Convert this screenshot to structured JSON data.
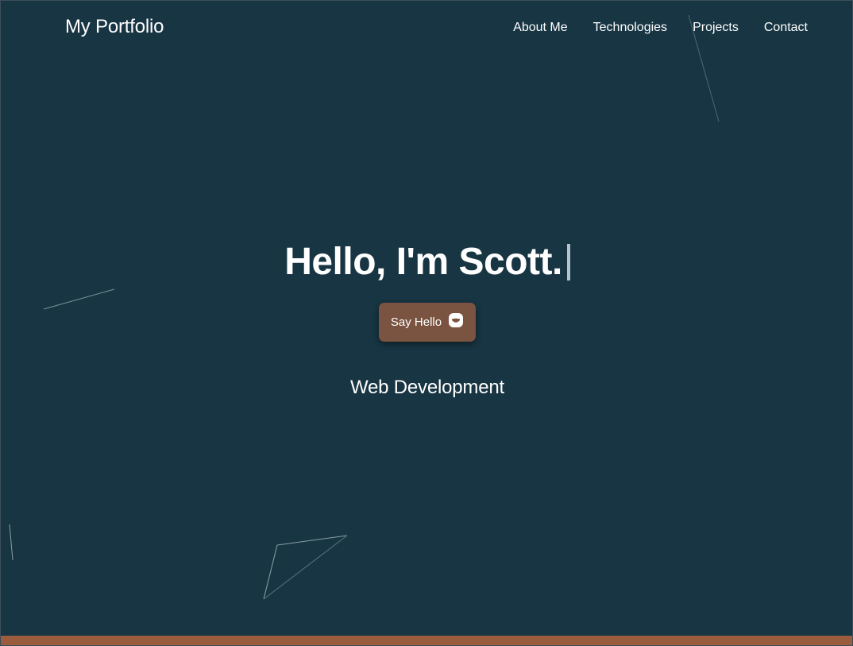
{
  "navbar": {
    "brand": "My Portfolio",
    "links": [
      {
        "label": "About Me"
      },
      {
        "label": "Technologies"
      },
      {
        "label": "Projects"
      },
      {
        "label": "Contact"
      }
    ]
  },
  "hero": {
    "heading": "Hello, I'm Scott.",
    "button_label": "Say Hello",
    "button_icon": "chat-icon",
    "subtitle": "Web Development"
  },
  "colors": {
    "background": "#183543",
    "accent": "#7a5440",
    "footer_bar": "#9a5c3c",
    "text": "#ffffff"
  }
}
